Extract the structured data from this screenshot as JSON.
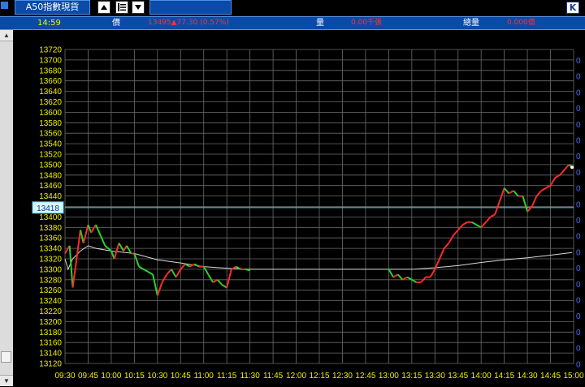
{
  "toolbar": {
    "title": "A50指數現貨",
    "k_label": "K"
  },
  "info": {
    "time": "14:59",
    "price_label": "價",
    "price_value": "13495▲77.30 (0.57%)",
    "volume_label": "量",
    "volume_value": "0.00千張",
    "total_label": "總量",
    "total_value": "0.000億"
  },
  "colors": {
    "up": "#ff2a2a",
    "down": "#2bd12b",
    "grid": "#6b6b6b",
    "axis_text": "#f0f000",
    "reference_line": "#3ad0e8",
    "average_line": "#d8d8d8",
    "toolbar_blue": "#0a4aa8"
  },
  "chart_data": {
    "type": "line",
    "ylim": [
      13120,
      13720
    ],
    "y_ticks": [
      13720,
      13700,
      13680,
      13660,
      13640,
      13620,
      13600,
      13580,
      13560,
      13540,
      13520,
      13500,
      13480,
      13460,
      13440,
      13420,
      13400,
      13380,
      13360,
      13340,
      13320,
      13300,
      13280,
      13260,
      13240,
      13220,
      13200,
      13180,
      13160,
      13140,
      13120
    ],
    "x_ticks": [
      "09:30",
      "09:45",
      "10:00",
      "10:15",
      "10:30",
      "10:45",
      "11:00",
      "11:15",
      "11:30",
      "11:45",
      "12:00",
      "12:15",
      "12:30",
      "12:45",
      "13:00",
      "13:15",
      "13:30",
      "13:45",
      "14:00",
      "14:15",
      "14:30",
      "14:45",
      "15:00"
    ],
    "reference_value": 13418,
    "reference_label": "13418",
    "right_axis_label": "0",
    "right_axis_count": 20,
    "price_series": [
      [
        "09:30",
        13330
      ],
      [
        "09:33",
        13345
      ],
      [
        "09:35",
        13265
      ],
      [
        "09:38",
        13330
      ],
      [
        "09:40",
        13375
      ],
      [
        "09:42",
        13350
      ],
      [
        "09:45",
        13385
      ],
      [
        "09:47",
        13370
      ],
      [
        "09:50",
        13385
      ],
      [
        "09:53",
        13365
      ],
      [
        "09:56",
        13345
      ],
      [
        "10:00",
        13335
      ],
      [
        "10:02",
        13320
      ],
      [
        "10:05",
        13350
      ],
      [
        "10:08",
        13335
      ],
      [
        "10:10",
        13345
      ],
      [
        "10:13",
        13330
      ],
      [
        "10:15",
        13330
      ],
      [
        "10:18",
        13305
      ],
      [
        "10:21",
        13300
      ],
      [
        "10:24",
        13295
      ],
      [
        "10:27",
        13290
      ],
      [
        "10:30",
        13250
      ],
      [
        "10:33",
        13275
      ],
      [
        "10:36",
        13290
      ],
      [
        "10:39",
        13300
      ],
      [
        "10:42",
        13285
      ],
      [
        "10:45",
        13300
      ],
      [
        "10:48",
        13310
      ],
      [
        "10:51",
        13305
      ],
      [
        "10:54",
        13310
      ],
      [
        "10:57",
        13305
      ],
      [
        "11:00",
        13305
      ],
      [
        "11:03",
        13290
      ],
      [
        "11:06",
        13275
      ],
      [
        "11:09",
        13280
      ],
      [
        "11:12",
        13270
      ],
      [
        "11:15",
        13265
      ],
      [
        "11:18",
        13300
      ],
      [
        "11:21",
        13305
      ],
      [
        "11:24",
        13300
      ],
      [
        "11:27",
        13300
      ],
      [
        "11:30",
        13298
      ],
      [
        "13:00",
        13300
      ],
      [
        "13:03",
        13285
      ],
      [
        "13:06",
        13290
      ],
      [
        "13:09",
        13280
      ],
      [
        "13:12",
        13285
      ],
      [
        "13:15",
        13280
      ],
      [
        "13:18",
        13275
      ],
      [
        "13:21",
        13275
      ],
      [
        "13:24",
        13285
      ],
      [
        "13:27",
        13285
      ],
      [
        "13:30",
        13300
      ],
      [
        "13:33",
        13320
      ],
      [
        "13:36",
        13340
      ],
      [
        "13:39",
        13350
      ],
      [
        "13:42",
        13365
      ],
      [
        "13:45",
        13375
      ],
      [
        "13:48",
        13385
      ],
      [
        "13:51",
        13390
      ],
      [
        "13:54",
        13390
      ],
      [
        "13:57",
        13385
      ],
      [
        "14:00",
        13380
      ],
      [
        "14:03",
        13390
      ],
      [
        "14:06",
        13400
      ],
      [
        "14:09",
        13405
      ],
      [
        "14:12",
        13430
      ],
      [
        "14:15",
        13455
      ],
      [
        "14:18",
        13445
      ],
      [
        "14:21",
        13450
      ],
      [
        "14:24",
        13440
      ],
      [
        "14:27",
        13440
      ],
      [
        "14:30",
        13410
      ],
      [
        "14:33",
        13420
      ],
      [
        "14:36",
        13440
      ],
      [
        "14:39",
        13450
      ],
      [
        "14:42",
        13455
      ],
      [
        "14:45",
        13460
      ],
      [
        "14:48",
        13475
      ],
      [
        "14:51",
        13480
      ],
      [
        "14:54",
        13490
      ],
      [
        "14:57",
        13500
      ],
      [
        "14:59",
        13495
      ]
    ],
    "average_series": [
      [
        "09:30",
        13320
      ],
      [
        "09:32",
        13300
      ],
      [
        "09:35",
        13320
      ],
      [
        "09:40",
        13335
      ],
      [
        "09:45",
        13345
      ],
      [
        "09:50",
        13340
      ],
      [
        "10:00",
        13335
      ],
      [
        "10:15",
        13330
      ],
      [
        "10:30",
        13318
      ],
      [
        "10:45",
        13312
      ],
      [
        "11:00",
        13305
      ],
      [
        "11:15",
        13302
      ],
      [
        "11:30",
        13300
      ],
      [
        "13:00",
        13300
      ],
      [
        "13:15",
        13300
      ],
      [
        "13:30",
        13303
      ],
      [
        "13:45",
        13307
      ],
      [
        "14:00",
        13313
      ],
      [
        "14:15",
        13318
      ],
      [
        "14:30",
        13322
      ],
      [
        "14:45",
        13327
      ],
      [
        "14:59",
        13332
      ]
    ]
  }
}
